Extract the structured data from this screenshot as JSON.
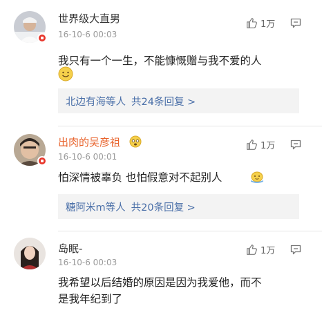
{
  "comments": [
    {
      "username": "世界级大直男",
      "time": "16-10-6 00:03",
      "like_count": "1万",
      "content": "我只有一个一生，不能慷慨赠与我不爱的人",
      "reply_users": "北边有海等人",
      "reply_total": "共24条回复 >",
      "name_color": "#333333"
    },
    {
      "username": "出肉的吴彦祖",
      "time": "16-10-6 00:01",
      "like_count": "1万",
      "content": "怕深情被辜负 也怕假意对不起别人",
      "reply_users": "糖阿米m等人",
      "reply_total": "共20条回复 >",
      "name_color": "#e8632c"
    },
    {
      "username": "岛眠-",
      "time": "16-10-6 00:03",
      "like_count": "1万",
      "content_line1": "我希望以后结婚的原因是因为我爱他，而不",
      "content_line2": "是我年纪到了",
      "name_color": "#333333"
    }
  ],
  "icons": {
    "like": "thumbs-up-icon",
    "reply": "comment-bubble-icon",
    "verified": "verified-badge-icon",
    "emoji1": "smiling-face-emoji",
    "emoji2": "sweating-face-emoji",
    "emoji3": "melting-face-emoji"
  }
}
